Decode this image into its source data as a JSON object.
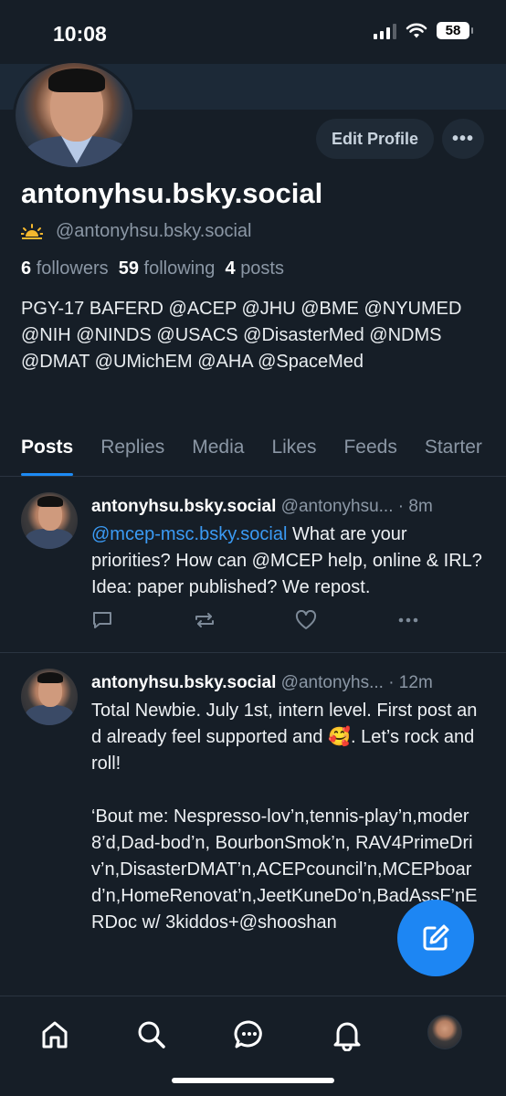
{
  "status_bar": {
    "time": "10:08",
    "battery": "58"
  },
  "profile": {
    "edit_label": "Edit Profile",
    "more_label": "•••",
    "display_name": "antonyhsu.bsky.social",
    "handle": "@antonyhsu.bsky.social",
    "followers_count": "6",
    "followers_label": "followers",
    "following_count": "59",
    "following_label": "following",
    "posts_count": "4",
    "posts_label": "posts",
    "bio": "PGY-17 BAFERD @ACEP @JHU @BME @NYUMED @NIH @NINDS @USACS @DisasterMed @NDMS @DMAT @UMichEM @AHA @SpaceMed"
  },
  "tabs": [
    {
      "label": "Posts"
    },
    {
      "label": "Replies"
    },
    {
      "label": "Media"
    },
    {
      "label": "Likes"
    },
    {
      "label": "Feeds"
    },
    {
      "label": "Starter"
    }
  ],
  "posts": [
    {
      "name": "antonyhsu.bsky.social",
      "handle": "@antonyhsu...",
      "time": "· 8m",
      "mention": "@mcep-msc.bsky.social",
      "text": " What are your priorities? How can @MCEP help, online & IRL? Idea: paper published? We repost."
    },
    {
      "name": "antonyhsu.bsky.social",
      "handle": "@antonyhs...",
      "time": "· 12m",
      "text": "Total Newbie. July 1st, intern level. First post and already feel supported and 🥰. Let’s rock and roll!\n\n‘Bout me: Nespresso-lov’n,tennis-play’n,moder8’d,Dad-bod’n, BourbonSmok’n, RAV4PrimeDriv’n,DisasterDMAT’n,ACEPcouncil’n,MCEPboard’n,HomeRenovat’n,JeetKuneDo’n,BadAssF’nERDoc w/ 3kiddos+@shooshan"
    }
  ],
  "icons": {
    "accent": "#1d8bf5",
    "nav": [
      "home-icon",
      "search-icon",
      "chat-icon",
      "bell-icon",
      "profile-avatar"
    ]
  }
}
